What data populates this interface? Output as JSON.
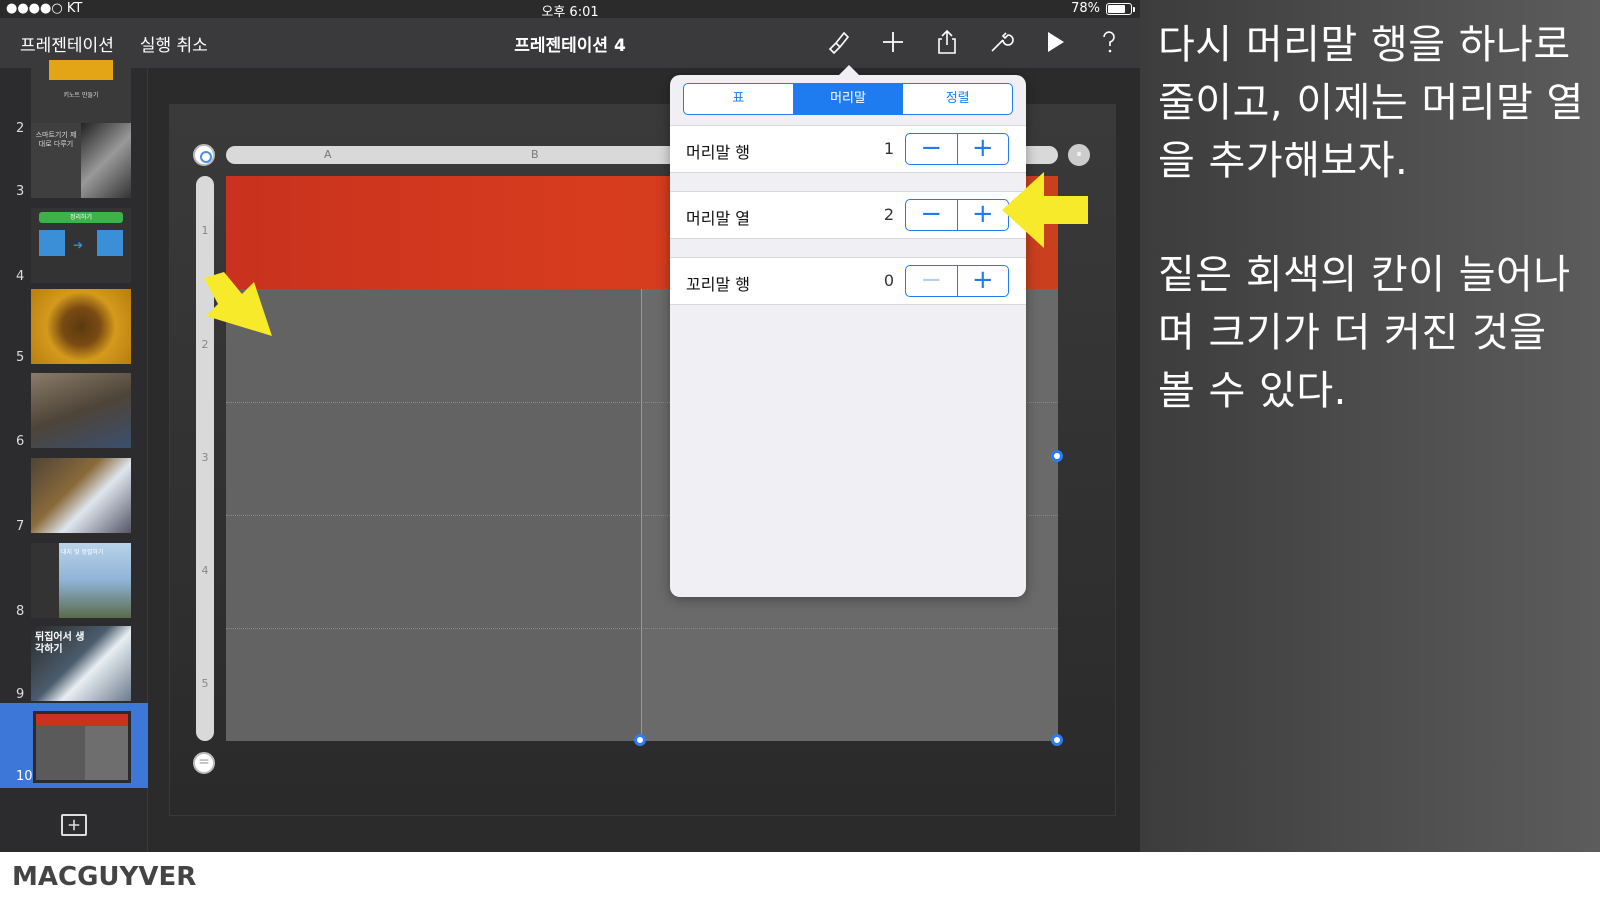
{
  "status": {
    "carrier": "●●●●○ KT",
    "time": "오후 6:01",
    "battery": "78%",
    "battery_level": 0.78
  },
  "toolbar": {
    "presentations": "프레젠테이션",
    "undo": "실행 취소",
    "title": "프레젠테이션 4"
  },
  "thumbnails": [
    {
      "num": "2",
      "caption": "키노트 만들기"
    },
    {
      "num": "3",
      "caption": "스마트기기 제대로 다루기"
    },
    {
      "num": "4",
      "caption": "정리하기"
    },
    {
      "num": "5"
    },
    {
      "num": "6"
    },
    {
      "num": "7"
    },
    {
      "num": "8",
      "caption": "대지 및 정렬하기"
    },
    {
      "num": "9",
      "caption": "뒤집어서 생각하기"
    },
    {
      "num": "10"
    }
  ],
  "table": {
    "col_labels": [
      "A",
      "B"
    ],
    "row_labels": [
      "1",
      "2",
      "3",
      "4",
      "5"
    ]
  },
  "popover": {
    "tabs": [
      "표",
      "머리말",
      "정렬"
    ],
    "active_tab": "머리말",
    "rows": [
      {
        "label": "머리말 행",
        "value": "1"
      },
      {
        "label": "머리말 열",
        "value": "2"
      },
      {
        "label": "꼬리말 행",
        "value": "0"
      }
    ],
    "minus": "−",
    "plus": "+"
  },
  "caption": {
    "p1": "다시 머리말 행을 하나로 줄이고, 이제는 머리말 열을 추가해보자.",
    "p2": "짙은 회색의 칸이 늘어나며 크기가 더 커진 것을 볼 수 있다."
  },
  "footer": {
    "brand": "MACGUYVER"
  },
  "colors": {
    "accent": "#1f7cf0",
    "header_red": "#d73c1e",
    "arrow": "#f6ea2a",
    "selected": "#3d78d8"
  }
}
